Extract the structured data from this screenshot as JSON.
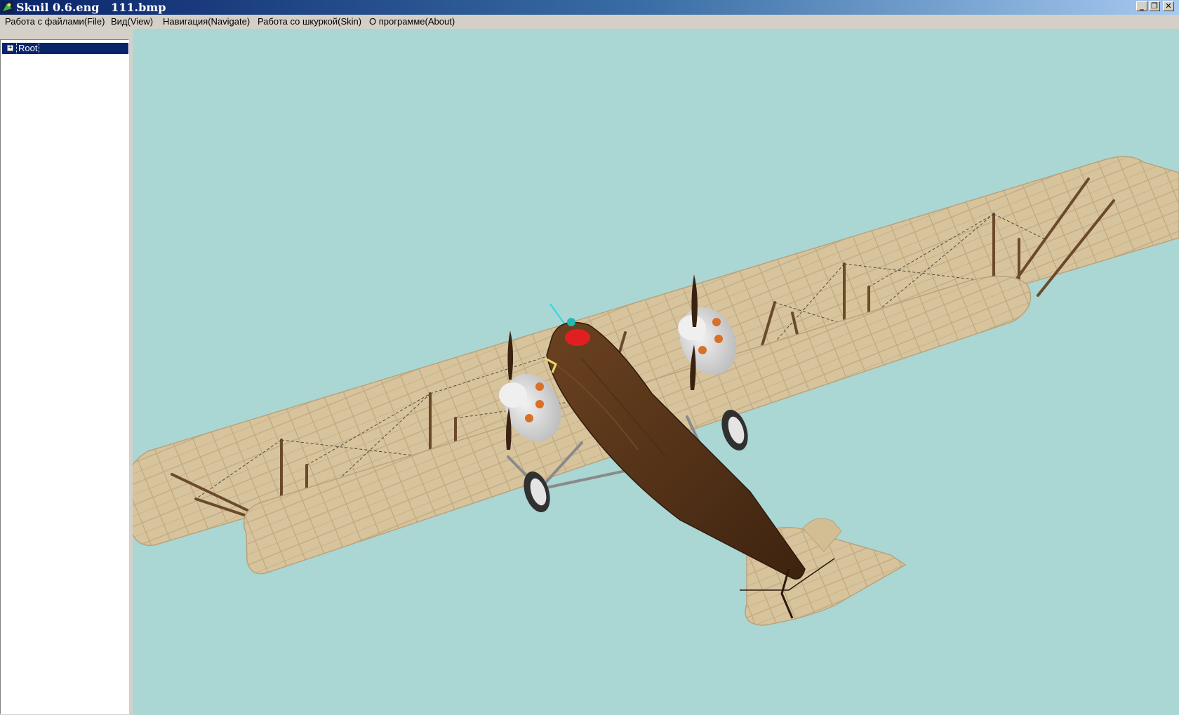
{
  "window": {
    "title": "Sknil 0.6.eng   111.bmp",
    "controls": {
      "minimize": "_",
      "restore": "❐",
      "close": "✕"
    }
  },
  "menu": {
    "items": [
      "Работа с файлами(File)",
      "Вид(View)",
      "Навигация(Navigate)",
      "Работа со шкуркой(Skin)",
      "О программе(About)"
    ]
  },
  "tree": {
    "expander": "+",
    "root_label": "Root"
  },
  "viewport": {
    "background": "#aad6d4",
    "model": "biplane",
    "colors": {
      "wing_fabric": "#d8c49c",
      "fuselage": "#5a3516",
      "engine": "#d6d6d6",
      "propeller": "#3a2210"
    }
  }
}
